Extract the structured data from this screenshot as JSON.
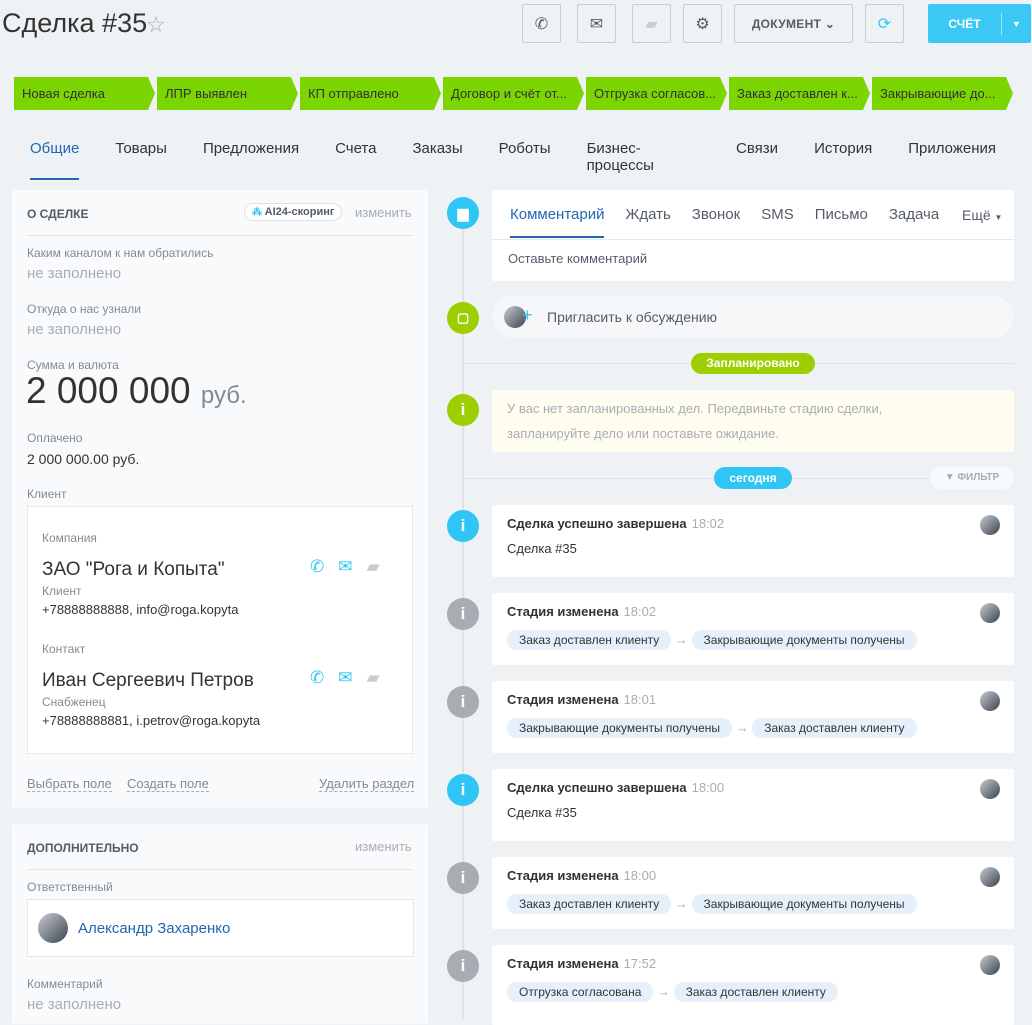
{
  "header": {
    "title": "Сделка #35",
    "document": "ДОКУМЕНТ",
    "invoice": "СЧЁТ"
  },
  "stages": [
    "Новая сделка",
    "ЛПР выявлен",
    "КП отправлено",
    "Договор и счёт от...",
    "Отгрузка согласов...",
    "Заказ доставлен к...",
    "Закрывающие до..."
  ],
  "tabs": [
    "Общие",
    "Товары",
    "Предложения",
    "Счета",
    "Заказы",
    "Роботы",
    "Бизнес-процессы",
    "Связи",
    "История",
    "Приложения"
  ],
  "about": {
    "heading": "О СДЕЛКЕ",
    "scoring": "AI24-скоринг",
    "edit": "изменить",
    "channel_label": "Каким каналом к нам обратились",
    "channel_value": "не заполнено",
    "source_label": "Откуда о нас узнали",
    "source_value": "не заполнено",
    "sum_label": "Сумма и валюта",
    "sum_value": "2 000 000",
    "sum_currency": "руб.",
    "paid_label": "Оплачено",
    "paid_value": "2 000 000.00 руб.",
    "client_label": "Клиент",
    "company_label": "Компания",
    "company_name": "ЗАО \"Рога и Копыта\"",
    "company_role": "Клиент",
    "company_contacts": "+78888888888, info@roga.kopyta",
    "contact_label": "Контакт",
    "contact_name": "Иван Сергеевич Петров",
    "contact_role": "Снабженец",
    "contact_contacts": "+78888888881, i.petrov@roga.kopyta",
    "select_field": "Выбрать поле",
    "create_field": "Создать поле",
    "delete_section": "Удалить раздел"
  },
  "extra": {
    "heading": "ДОПОЛНИТЕЛЬНО",
    "edit": "изменить",
    "responsible_label": "Ответственный",
    "responsible_name": "Александр Захаренко",
    "comment_label": "Комментарий",
    "comment_value": "не заполнено"
  },
  "composer": {
    "tabs": [
      "Комментарий",
      "Ждать",
      "Звонок",
      "SMS",
      "Письмо",
      "Задача"
    ],
    "more": "Ещё",
    "placeholder": "Оставьте комментарий"
  },
  "invite": "Пригласить к обсуждению",
  "planned": {
    "badge": "Запланировано",
    "text1": "У вас нет запланированных дел. Передвиньте стадию сделки,",
    "text2": "запланируйте дело или поставьте ожидание."
  },
  "today": "сегодня",
  "filter": "ФИЛЬТР",
  "timeline": [
    {
      "kind": "done",
      "title": "Сделка успешно завершена",
      "time": "18:02",
      "text": "Сделка #35"
    },
    {
      "kind": "stage",
      "title": "Стадия изменена",
      "time": "18:02",
      "from": "Заказ доставлен клиенту",
      "to": "Закрывающие документы получены"
    },
    {
      "kind": "stage",
      "title": "Стадия изменена",
      "time": "18:01",
      "from": "Закрывающие документы получены",
      "to": "Заказ доставлен клиенту"
    },
    {
      "kind": "done",
      "title": "Сделка успешно завершена",
      "time": "18:00",
      "text": "Сделка #35"
    },
    {
      "kind": "stage",
      "title": "Стадия изменена",
      "time": "18:00",
      "from": "Заказ доставлен клиенту",
      "to": "Закрывающие документы получены"
    },
    {
      "kind": "stage",
      "title": "Стадия изменена",
      "time": "17:52",
      "from": "Отгрузка согласована",
      "to": "Заказ доставлен клиенту"
    }
  ],
  "colors": {
    "accent": "#2fc6f6",
    "stage": "#7bd500",
    "planned": "#9dcf00",
    "grey": "#a8adb4"
  }
}
